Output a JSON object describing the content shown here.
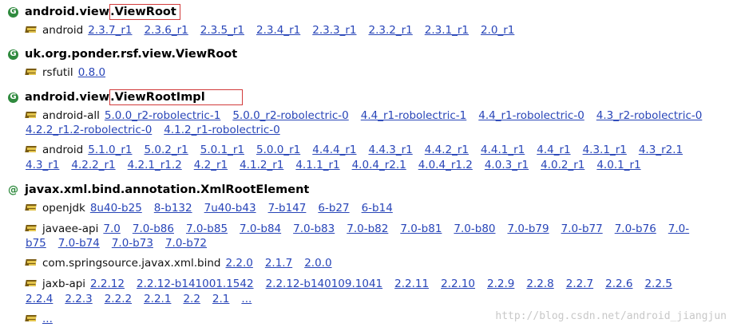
{
  "classes": [
    {
      "prefix": "android.view",
      "suffix": ".ViewRoot",
      "icon": "class-icon",
      "glyph": "G"
    },
    {
      "name": "uk.org.ponder.rsf.view.ViewRoot",
      "icon": "class-icon",
      "glyph": "G"
    },
    {
      "prefix": "android.view",
      "suffix": ".ViewRootImpl",
      "icon": "class-icon",
      "glyph": "G"
    },
    {
      "name": "javax.xml.bind.annotation.XmlRootElement",
      "icon": "annotation-icon",
      "glyph": "@"
    }
  ],
  "artifacts": [
    {
      "name": "android",
      "versions": [
        "2.3.7_r1",
        "2.3.6_r1",
        "2.3.5_r1",
        "2.3.4_r1",
        "2.3.3_r1",
        "2.3.2_r1",
        "2.3.1_r1",
        "2.0_r1"
      ]
    },
    {
      "name": "rsfutil",
      "versions": [
        "0.8.0"
      ]
    },
    {
      "name": "android-all",
      "versions": [
        "5.0.0_r2-robolectric-1",
        "5.0.0_r2-robolectric-0",
        "4.4_r1-robolectric-1",
        "4.4_r1-robolectric-0",
        "4.3_r2-robolectric-0"
      ],
      "versions2": [
        "4.2.2_r1.2-robolectric-0",
        "4.1.2_r1-robolectric-0"
      ]
    },
    {
      "name": "android",
      "versions": [
        "5.1.0_r1",
        "5.0.2_r1",
        "5.0.1_r1",
        "5.0.0_r1",
        "4.4.4_r1",
        "4.4.3_r1",
        "4.4.2_r1",
        "4.4.1_r1",
        "4.4_r1",
        "4.3.1_r1",
        "4.3_r2.1"
      ],
      "versions2": [
        "4.3_r1",
        "4.2.2_r1",
        "4.2.1_r1.2",
        "4.2_r1",
        "4.1.2_r1",
        "4.1.1_r1",
        "4.0.4_r2.1",
        "4.0.4_r1.2",
        "4.0.3_r1",
        "4.0.2_r1",
        "4.0.1_r1"
      ]
    },
    {
      "name": "openjdk",
      "versions": [
        "8u40-b25",
        "8-b132",
        "7u40-b43",
        "7-b147",
        "6-b27",
        "6-b14"
      ]
    },
    {
      "name": "javaee-api",
      "versions": [
        "7.0",
        "7.0-b86",
        "7.0-b85",
        "7.0-b84",
        "7.0-b83",
        "7.0-b82",
        "7.0-b81",
        "7.0-b80",
        "7.0-b79",
        "7.0-b77",
        "7.0-b76",
        "7.0-"
      ],
      "versions2": [
        "b75",
        "7.0-b74",
        "7.0-b73",
        "7.0-b72"
      ]
    },
    {
      "name": "com.springsource.javax.xml.bind",
      "versions": [
        "2.2.0",
        "2.1.7",
        "2.0.0"
      ]
    },
    {
      "name": "jaxb-api",
      "versions": [
        "2.2.12",
        "2.2.12-b141001.1542",
        "2.2.12-b140109.1041",
        "2.2.11",
        "2.2.10",
        "2.2.9",
        "2.2.8",
        "2.2.7",
        "2.2.6",
        "2.2.5"
      ],
      "versions2": [
        "2.2.4",
        "2.2.3",
        "2.2.2",
        "2.2.1",
        "2.2",
        "2.1",
        "..."
      ]
    },
    {
      "name": "",
      "versions": [
        "..."
      ]
    }
  ],
  "watermark": "http://blog.csdn.net/android_jiangjun",
  "colors": {
    "link": "#2845b8",
    "icon": "#2f8a3e",
    "highlight": "#d23b3b"
  }
}
